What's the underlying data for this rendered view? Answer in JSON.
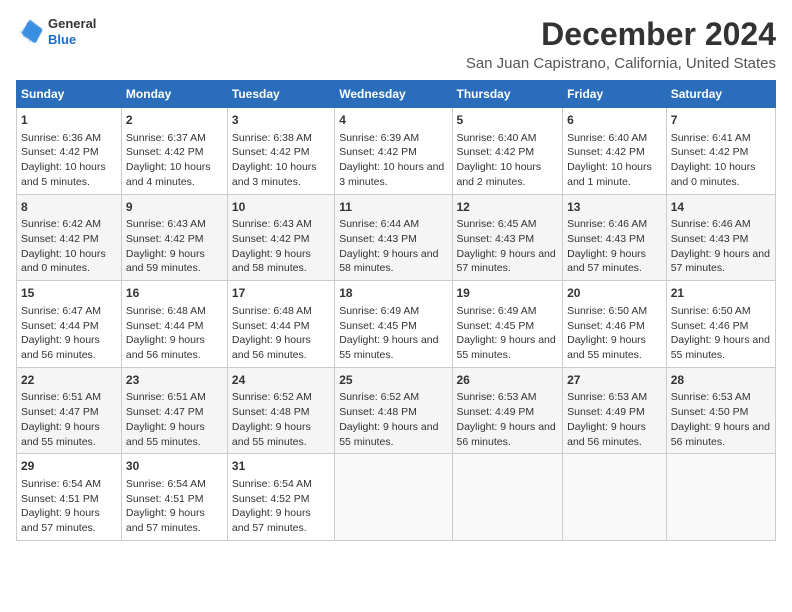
{
  "header": {
    "logo_line1": "General",
    "logo_line2": "Blue",
    "main_title": "December 2024",
    "subtitle": "San Juan Capistrano, California, United States"
  },
  "columns": [
    "Sunday",
    "Monday",
    "Tuesday",
    "Wednesday",
    "Thursday",
    "Friday",
    "Saturday"
  ],
  "weeks": [
    [
      {
        "day": "1",
        "text": "Sunrise: 6:36 AM\nSunset: 4:42 PM\nDaylight: 10 hours and 5 minutes."
      },
      {
        "day": "2",
        "text": "Sunrise: 6:37 AM\nSunset: 4:42 PM\nDaylight: 10 hours and 4 minutes."
      },
      {
        "day": "3",
        "text": "Sunrise: 6:38 AM\nSunset: 4:42 PM\nDaylight: 10 hours and 3 minutes."
      },
      {
        "day": "4",
        "text": "Sunrise: 6:39 AM\nSunset: 4:42 PM\nDaylight: 10 hours and 3 minutes."
      },
      {
        "day": "5",
        "text": "Sunrise: 6:40 AM\nSunset: 4:42 PM\nDaylight: 10 hours and 2 minutes."
      },
      {
        "day": "6",
        "text": "Sunrise: 6:40 AM\nSunset: 4:42 PM\nDaylight: 10 hours and 1 minute."
      },
      {
        "day": "7",
        "text": "Sunrise: 6:41 AM\nSunset: 4:42 PM\nDaylight: 10 hours and 0 minutes."
      }
    ],
    [
      {
        "day": "8",
        "text": "Sunrise: 6:42 AM\nSunset: 4:42 PM\nDaylight: 10 hours and 0 minutes."
      },
      {
        "day": "9",
        "text": "Sunrise: 6:43 AM\nSunset: 4:42 PM\nDaylight: 9 hours and 59 minutes."
      },
      {
        "day": "10",
        "text": "Sunrise: 6:43 AM\nSunset: 4:42 PM\nDaylight: 9 hours and 58 minutes."
      },
      {
        "day": "11",
        "text": "Sunrise: 6:44 AM\nSunset: 4:43 PM\nDaylight: 9 hours and 58 minutes."
      },
      {
        "day": "12",
        "text": "Sunrise: 6:45 AM\nSunset: 4:43 PM\nDaylight: 9 hours and 57 minutes."
      },
      {
        "day": "13",
        "text": "Sunrise: 6:46 AM\nSunset: 4:43 PM\nDaylight: 9 hours and 57 minutes."
      },
      {
        "day": "14",
        "text": "Sunrise: 6:46 AM\nSunset: 4:43 PM\nDaylight: 9 hours and 57 minutes."
      }
    ],
    [
      {
        "day": "15",
        "text": "Sunrise: 6:47 AM\nSunset: 4:44 PM\nDaylight: 9 hours and 56 minutes."
      },
      {
        "day": "16",
        "text": "Sunrise: 6:48 AM\nSunset: 4:44 PM\nDaylight: 9 hours and 56 minutes."
      },
      {
        "day": "17",
        "text": "Sunrise: 6:48 AM\nSunset: 4:44 PM\nDaylight: 9 hours and 56 minutes."
      },
      {
        "day": "18",
        "text": "Sunrise: 6:49 AM\nSunset: 4:45 PM\nDaylight: 9 hours and 55 minutes."
      },
      {
        "day": "19",
        "text": "Sunrise: 6:49 AM\nSunset: 4:45 PM\nDaylight: 9 hours and 55 minutes."
      },
      {
        "day": "20",
        "text": "Sunrise: 6:50 AM\nSunset: 4:46 PM\nDaylight: 9 hours and 55 minutes."
      },
      {
        "day": "21",
        "text": "Sunrise: 6:50 AM\nSunset: 4:46 PM\nDaylight: 9 hours and 55 minutes."
      }
    ],
    [
      {
        "day": "22",
        "text": "Sunrise: 6:51 AM\nSunset: 4:47 PM\nDaylight: 9 hours and 55 minutes."
      },
      {
        "day": "23",
        "text": "Sunrise: 6:51 AM\nSunset: 4:47 PM\nDaylight: 9 hours and 55 minutes."
      },
      {
        "day": "24",
        "text": "Sunrise: 6:52 AM\nSunset: 4:48 PM\nDaylight: 9 hours and 55 minutes."
      },
      {
        "day": "25",
        "text": "Sunrise: 6:52 AM\nSunset: 4:48 PM\nDaylight: 9 hours and 55 minutes."
      },
      {
        "day": "26",
        "text": "Sunrise: 6:53 AM\nSunset: 4:49 PM\nDaylight: 9 hours and 56 minutes."
      },
      {
        "day": "27",
        "text": "Sunrise: 6:53 AM\nSunset: 4:49 PM\nDaylight: 9 hours and 56 minutes."
      },
      {
        "day": "28",
        "text": "Sunrise: 6:53 AM\nSunset: 4:50 PM\nDaylight: 9 hours and 56 minutes."
      }
    ],
    [
      {
        "day": "29",
        "text": "Sunrise: 6:54 AM\nSunset: 4:51 PM\nDaylight: 9 hours and 57 minutes."
      },
      {
        "day": "30",
        "text": "Sunrise: 6:54 AM\nSunset: 4:51 PM\nDaylight: 9 hours and 57 minutes."
      },
      {
        "day": "31",
        "text": "Sunrise: 6:54 AM\nSunset: 4:52 PM\nDaylight: 9 hours and 57 minutes."
      },
      null,
      null,
      null,
      null
    ]
  ]
}
